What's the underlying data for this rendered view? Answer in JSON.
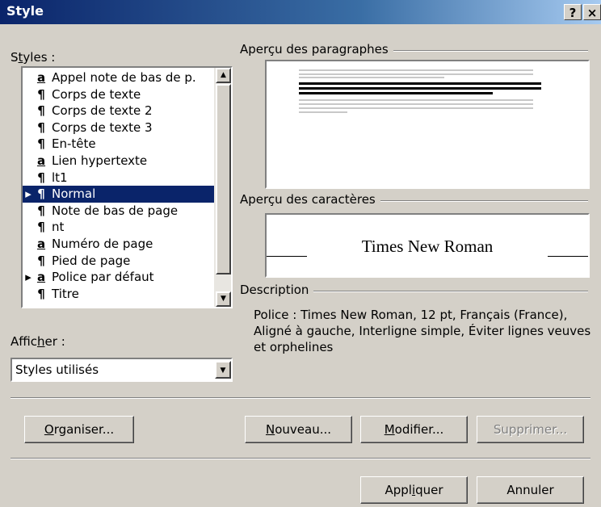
{
  "window": {
    "title": "Style",
    "help_label": "?",
    "close_label": "×"
  },
  "styles_label": {
    "pre": "S",
    "u": "t",
    "post": "yles :"
  },
  "styles": [
    {
      "icon": "a",
      "label": "Appel note de bas de p.",
      "marker": ""
    },
    {
      "icon": "¶",
      "label": "Corps de texte",
      "marker": ""
    },
    {
      "icon": "¶",
      "label": "Corps de texte 2",
      "marker": ""
    },
    {
      "icon": "¶",
      "label": "Corps de texte 3",
      "marker": ""
    },
    {
      "icon": "¶",
      "label": "En-tête",
      "marker": ""
    },
    {
      "icon": "a",
      "label": "Lien hypertexte",
      "marker": ""
    },
    {
      "icon": "¶",
      "label": "lt1",
      "marker": ""
    },
    {
      "icon": "¶",
      "label": "Normal",
      "marker": "▸",
      "selected": true
    },
    {
      "icon": "¶",
      "label": "Note de bas de page",
      "marker": ""
    },
    {
      "icon": "¶",
      "label": "nt",
      "marker": ""
    },
    {
      "icon": "a",
      "label": "Numéro de page",
      "marker": ""
    },
    {
      "icon": "¶",
      "label": "Pied de page",
      "marker": ""
    },
    {
      "icon": "a",
      "label": "Police par défaut",
      "marker": "▸"
    },
    {
      "icon": "¶",
      "label": "Titre",
      "marker": ""
    }
  ],
  "show_label": {
    "pre": "Affic",
    "u": "h",
    "post": "er :"
  },
  "show_select": {
    "value": "Styles utilisés"
  },
  "paragraph_preview": {
    "label": "Aperçu des paragraphes"
  },
  "char_preview": {
    "label": "Aperçu des caractères",
    "sample": "Times New Roman"
  },
  "description": {
    "label": "Description",
    "text": "Police : Times New Roman, 12 pt, Français (France), Aligné à gauche, Interligne simple, Éviter lignes veuves et orphelines"
  },
  "buttons": {
    "organiser": {
      "u": "O",
      "rest": "rganiser..."
    },
    "nouveau": {
      "u": "N",
      "rest": "ouveau..."
    },
    "modifier": {
      "u": "M",
      "rest": "odifier..."
    },
    "supprimer": {
      "label": "Supprimer..."
    },
    "appliquer": {
      "pre": "Appl",
      "u": "i",
      "post": "quer"
    },
    "annuler": {
      "label": "Annuler"
    }
  },
  "colors": {
    "selection": "#0a246a",
    "dialog": "#d4d0c8"
  }
}
